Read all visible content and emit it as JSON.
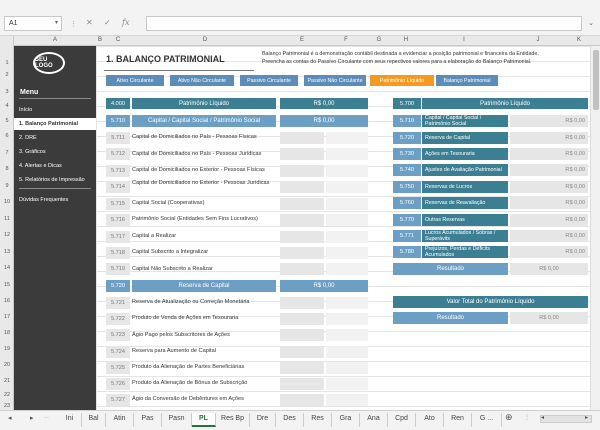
{
  "formula": {
    "cell_ref": "A1",
    "fx": "fx",
    "value": ""
  },
  "columns": [
    "A",
    "B",
    "C",
    "D",
    "E",
    "F",
    "G",
    "H",
    "I",
    "J",
    "K"
  ],
  "rows": [
    "1",
    "2",
    "3",
    "4",
    "5",
    "6",
    "7",
    "8",
    "9",
    "10",
    "11",
    "12",
    "13",
    "14",
    "15",
    "16",
    "17",
    "18",
    "19",
    "20",
    "21",
    "22",
    "23"
  ],
  "sidebar": {
    "logo": "SEU LOGO",
    "menu_title": "Menu",
    "items": [
      {
        "label": "Início"
      },
      {
        "label": "1. Balanço Patrimonial"
      },
      {
        "label": "2. DRE"
      },
      {
        "label": "3. Gráficos"
      },
      {
        "label": "4. Alertas e Dicas"
      },
      {
        "label": "5. Relatórios de Impressão"
      },
      {
        "label": "Dúvidas Frequentes"
      }
    ]
  },
  "page": {
    "title": "1. BALANÇO PATRIMONIAL",
    "desc1": "Balanço Patrimonial é a demonstração contábil destinada a evidenciar a posição patrimonial e financeira da Entidade.",
    "desc2": "Preencha as contas do Passivo Circulante com seus repectivos valores para a elaboração do Balanço Patrimonial."
  },
  "nav_tabs": [
    {
      "label": "Ativo Circulante"
    },
    {
      "label": "Ativo Não Circulante"
    },
    {
      "label": "Passivo Circulante"
    },
    {
      "label": "Passivo Não Circulante"
    },
    {
      "label": "Patrimônio Líquido"
    },
    {
      "label": "Balanço Patrimonial"
    }
  ],
  "left_table": {
    "code": "4.000",
    "header": "Patrimônio Líquido",
    "header_value": "R$ 0,00",
    "section1": {
      "code": "5.710",
      "label": "Capital / Capital Social / Patrimônio Social",
      "value": "R$ 0,00"
    },
    "rows1": [
      {
        "code": "5.711",
        "label": "Capital de Domiciliados no País - Pessoas Físicas"
      },
      {
        "code": "5.712",
        "label": "Capital de Domiciliados no País - Pessoas Jurídicas"
      },
      {
        "code": "5.713",
        "label": "Capital de Domiciliados no Exterior - Pessoas Físicas"
      },
      {
        "code": "5.714",
        "label": "Capital de Domiciliados no Exterior - Pessoas Jurídicas"
      },
      {
        "code": "5.715",
        "label": "Capital Social (Cooperativas)"
      },
      {
        "code": "5.716",
        "label": "Patrimônio Social (Entidades Sem Fins Lucrativos)"
      },
      {
        "code": "5.717",
        "label": "Capital a Realizar"
      },
      {
        "code": "5.718",
        "label": "Capital Subscrito a Integralizar"
      },
      {
        "code": "5.719",
        "label": "Capital Não Subscrito a Realizar"
      }
    ],
    "section2": {
      "code": "5.720",
      "label": "Reserva de Capital",
      "value": "R$ 0,00"
    },
    "rows2": [
      {
        "code": "5.721",
        "label": "Reserva de Atualização ou Correção Monetária"
      },
      {
        "code": "5.722",
        "label": "Produto de Venda de Ações em Tesouraria"
      },
      {
        "code": "5.723",
        "label": "Ágio Pago pelos Subscritores de Ações"
      },
      {
        "code": "5.724",
        "label": "Reserva para Aumento de Capital"
      },
      {
        "code": "5.725",
        "label": "Produto da Alienação de Partes Beneficiárias"
      },
      {
        "code": "5.726",
        "label": "Produto da Alienação de Bônus de Subscrição"
      },
      {
        "code": "5.727",
        "label": "Ágio da Conversão de Debêntures em Ações"
      }
    ]
  },
  "right_table": {
    "code": "5.700",
    "header": "Patrimônio Líquido",
    "rows": [
      {
        "code": "5.710",
        "label": "Capital / Capital Social / Patrimônio Social",
        "value": "R$ 0,00"
      },
      {
        "code": "5.720",
        "label": "Reserva de Capital",
        "value": "R$ 0,00"
      },
      {
        "code": "5.730",
        "label": "Ações em Tesouraria",
        "value": "R$ 0,00"
      },
      {
        "code": "5.740",
        "label": "Ajustes de Avaliação Patrimonial",
        "value": "R$ 0,00"
      },
      {
        "code": "5.750",
        "label": "Reservas de Lucros",
        "value": "R$ 0,00"
      },
      {
        "code": "5.760",
        "label": "Reservas de Reavaliação",
        "value": "R$ 0,00"
      },
      {
        "code": "5.770",
        "label": "Outras Reservas",
        "value": "R$ 0,00"
      },
      {
        "code": "5.771",
        "label": "Lucros Acumulados / Sobras / Superávits",
        "value": "R$ 0,00"
      },
      {
        "code": "5.780",
        "label": "Prejuízos, Perdas e Déficits Acumulados",
        "value": "R$ 0,00"
      }
    ],
    "result_label": "Resultado",
    "result_value": "R$ 0,00",
    "total_header": "Valor Total do Patrimônio Líquido",
    "total_label": "Resultado",
    "total_value": "R$ 0,00"
  },
  "sheets": [
    "Ini",
    "Bal",
    "Atin",
    "Pas",
    "Pasn",
    "PL",
    "Res Bp",
    "Dre",
    "Des",
    "Res",
    "Gra",
    "Ana",
    "Cpd",
    "Ato",
    "Ren",
    "G ..."
  ],
  "active_sheet": "PL"
}
